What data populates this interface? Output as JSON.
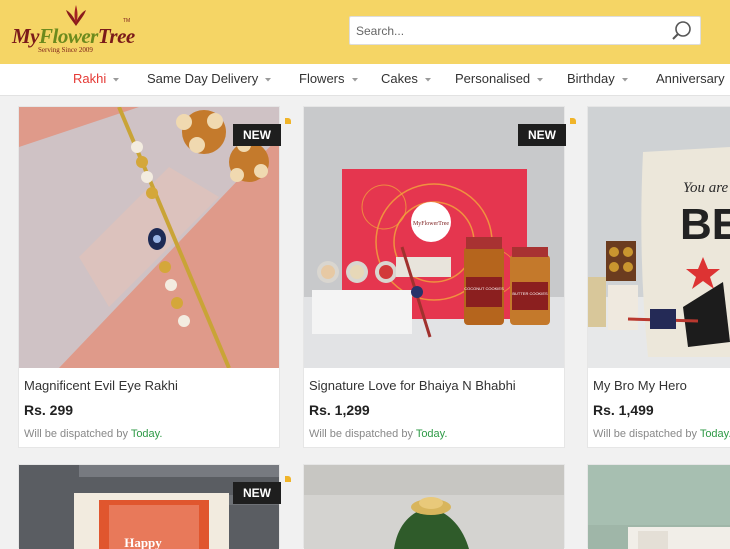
{
  "brand": {
    "logo_my": "My",
    "logo_flower": "Flower",
    "logo_tree": "Tree",
    "tagline": "Serving Since 2009",
    "trademark": "TM"
  },
  "search": {
    "placeholder": "Search..."
  },
  "nav": [
    {
      "label": "Rakhi",
      "active": true
    },
    {
      "label": "Same Day Delivery"
    },
    {
      "label": "Flowers"
    },
    {
      "label": "Cakes"
    },
    {
      "label": "Personalised"
    },
    {
      "label": "Birthday"
    },
    {
      "label": "Anniversary"
    }
  ],
  "products": [
    {
      "name": "Magnificent Evil Eye Rakhi",
      "price": "Rs. 299",
      "dispatch_prefix": "Will be dispatched by",
      "dispatch_day": "Today.",
      "badge": "NEW"
    },
    {
      "name": "Signature Love for Bhaiya N Bhabhi",
      "price": "Rs. 1,299",
      "dispatch_prefix": "Will be dispatched by",
      "dispatch_day": "Today.",
      "badge": "NEW",
      "image_text": {
        "box_brand": "MyFlowerTree",
        "jar1": "COCONUT COOKIES",
        "jar2": "BUTTER COOKIES"
      }
    },
    {
      "name": "My Bro My Hero",
      "price": "Rs. 1,499",
      "dispatch_prefix": "Will be dispatched by",
      "dispatch_day": "Today.",
      "image_text": {
        "pillow_top": "You are",
        "pillow_big": "BE"
      }
    },
    {
      "badge": "NEW",
      "image_text": {
        "tag": "Happy"
      }
    },
    {},
    {}
  ],
  "colors": {
    "header_bg": "#f5d565",
    "active_nav": "#e53935",
    "today_green": "#2e9a46",
    "badge_bg": "#1e1e1e"
  }
}
